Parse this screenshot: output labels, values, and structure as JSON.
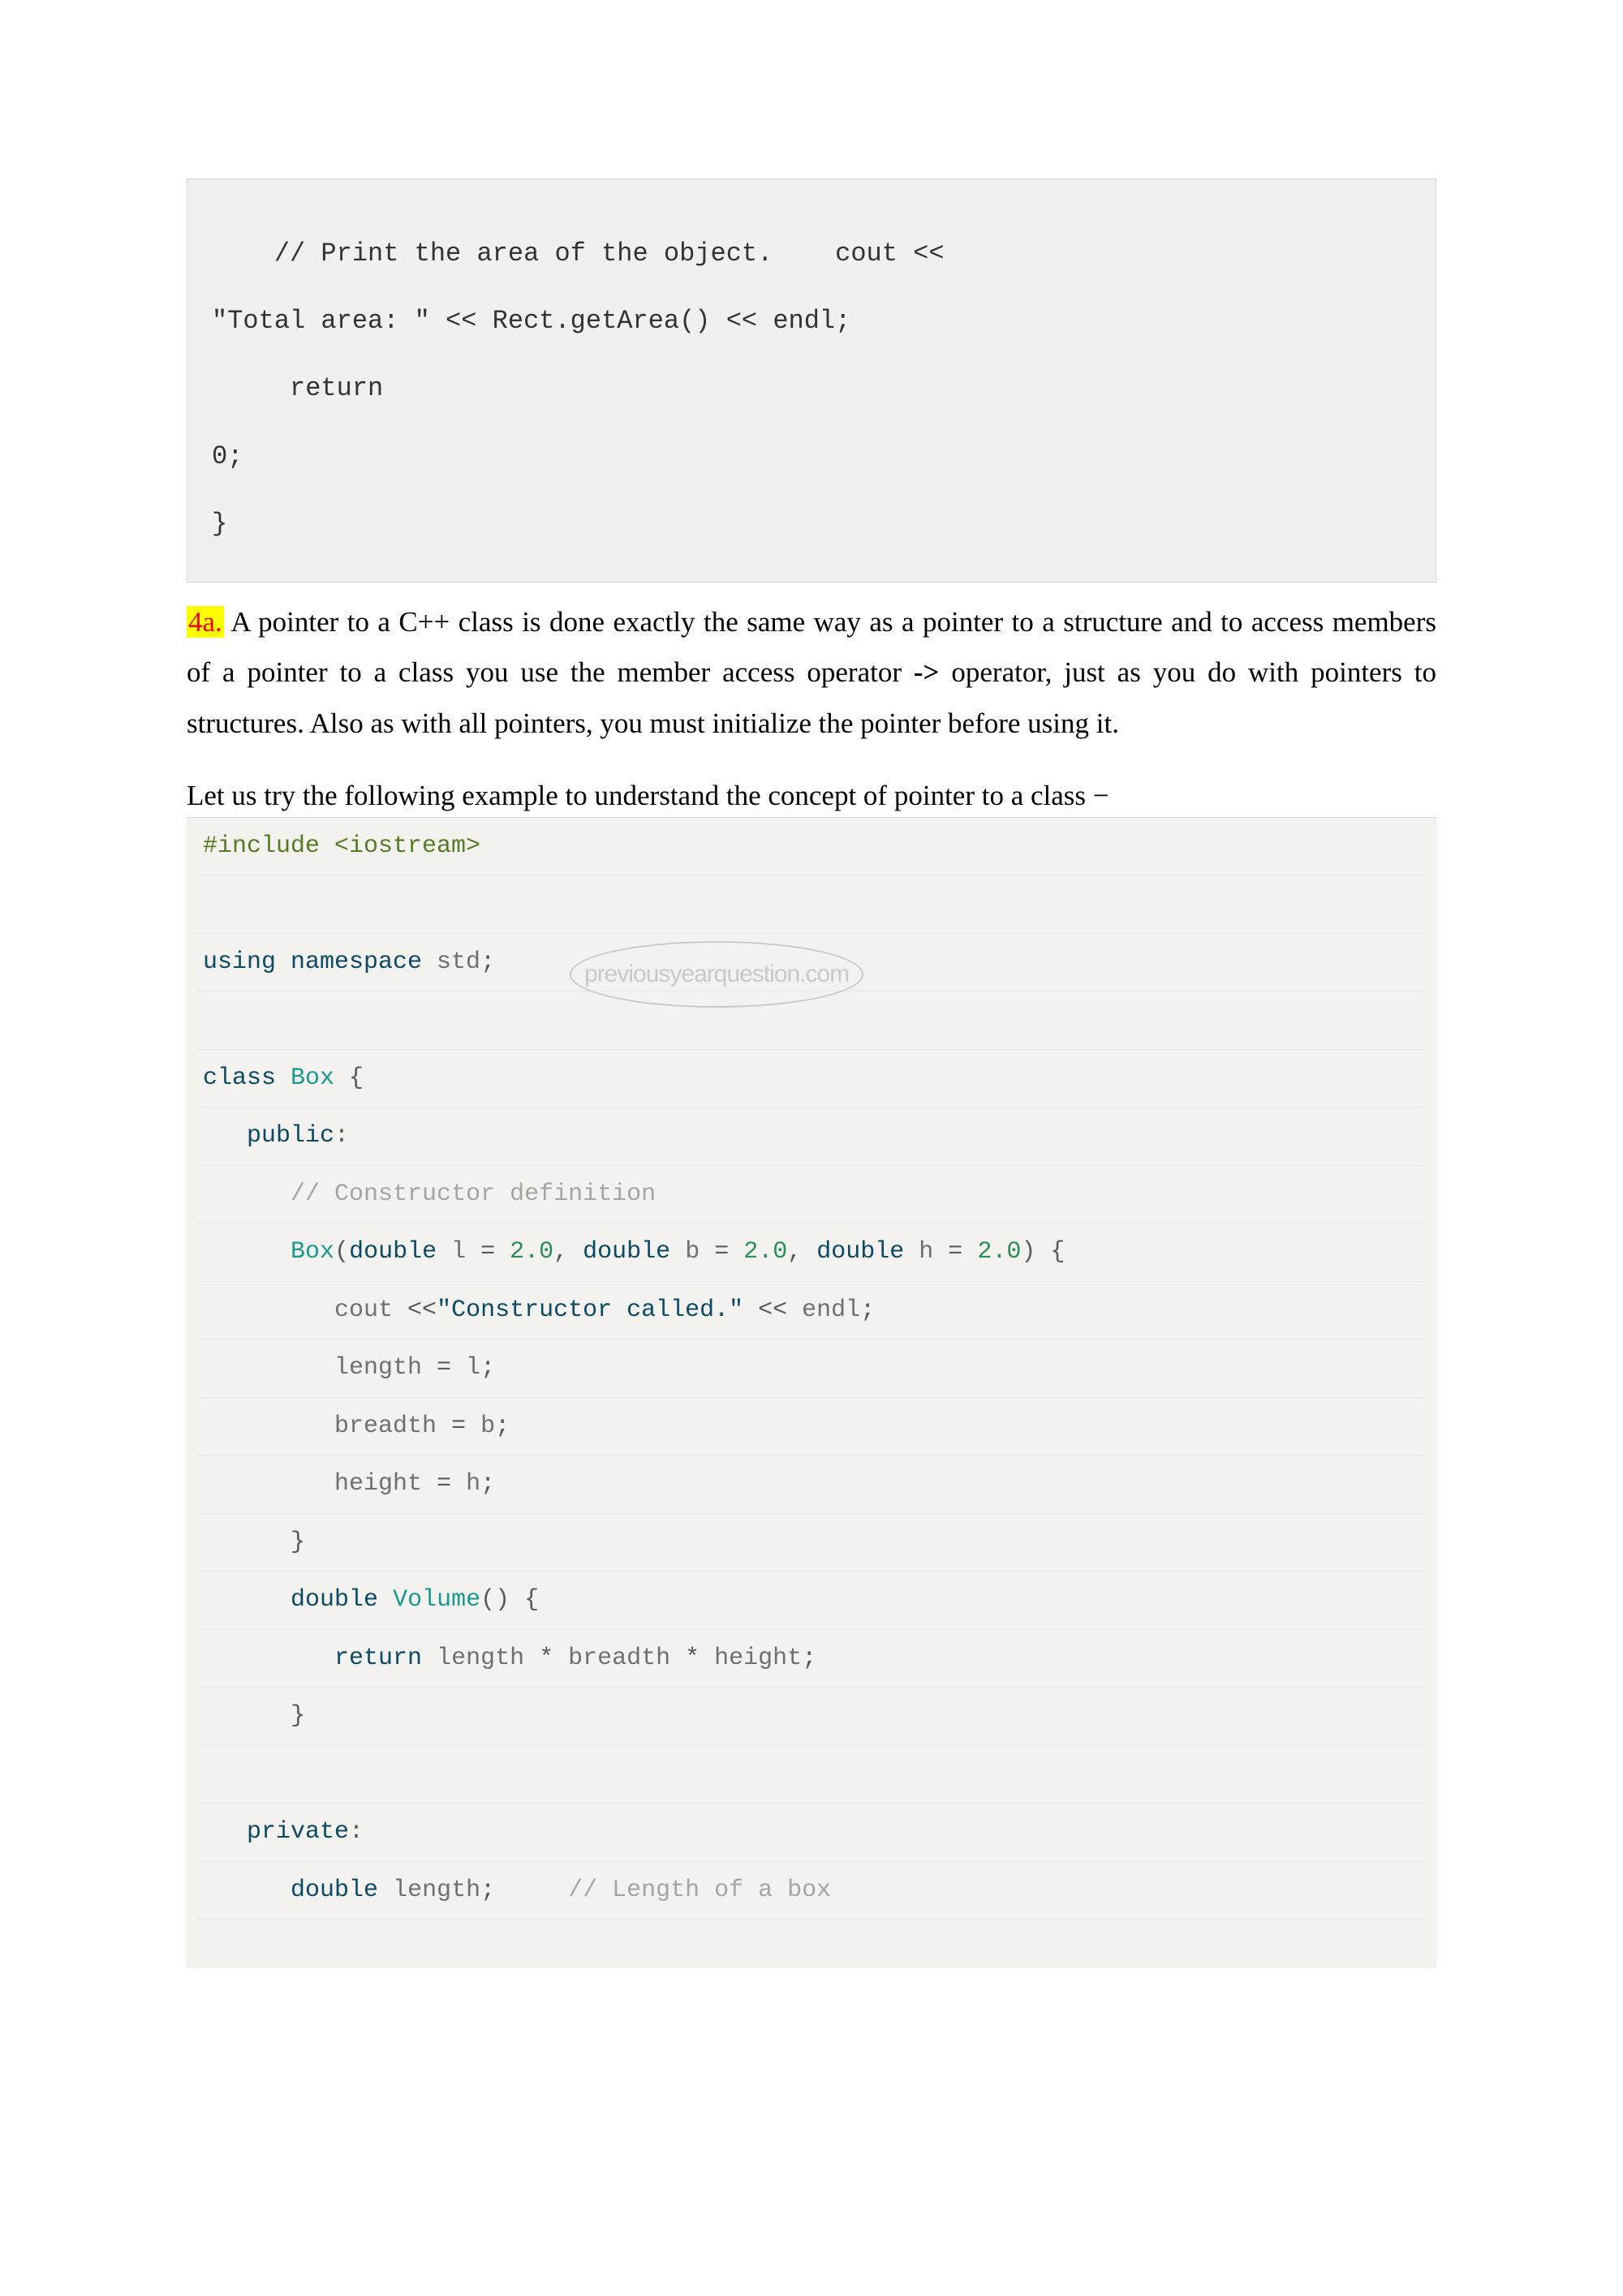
{
  "code1": {
    "l1": "    // Print the area of the object.    cout <<",
    "l2": "\"Total area: \" << Rect.getArea() << endl;",
    "l3": "     return",
    "l4": "0;",
    "l5": "}"
  },
  "para": {
    "tag": "4a.",
    "text1": " A pointer to a C++ class is done exactly the same way as a pointer to a structure and to access members of a pointer to a class you use the member access operator ",
    "op": "->",
    "text2": " operator, just as you do with pointers to structures. Also as with all pointers, you must initialize the pointer before using it."
  },
  "lead": "Let us try the following example to understand the concept of pointer to a class −",
  "watermark": "previousyearquestion.com",
  "code2": {
    "r1_a": "#include ",
    "r1_b": "<iostream>",
    "r2": "",
    "r3_a": "using",
    "r3_b": " namespace",
    "r3_c": " std",
    "r3_d": ";",
    "r4": "",
    "r5_a": "class",
    "r5_b": " Box ",
    "r5_c": "{",
    "r6_a": "   ",
    "r6_b": "public",
    "r6_c": ":",
    "r7_a": "      ",
    "r7_b": "// Constructor definition",
    "r8_a": "      ",
    "r8_b": "Box",
    "r8_c": "(",
    "r8_d": "double",
    "r8_e": " l ",
    "r8_f": "=",
    "r8_g": " 2.0",
    "r8_h": ",",
    "r8_i": " double",
    "r8_j": " b ",
    "r8_k": "=",
    "r8_l": " 2.0",
    "r8_m": ",",
    "r8_n": " double",
    "r8_o": " h ",
    "r8_p": "=",
    "r8_q": " 2.0",
    "r8_r": ")",
    "r8_s": " {",
    "r9_a": "         cout ",
    "r9_b": "<<",
    "r9_c": "\"Constructor called.\"",
    "r9_d": " <<",
    "r9_e": " endl",
    "r9_f": ";",
    "r10_a": "         length ",
    "r10_b": "=",
    "r10_c": " l",
    "r10_d": ";",
    "r11_a": "         breadth ",
    "r11_b": "=",
    "r11_c": " b",
    "r11_d": ";",
    "r12_a": "         height ",
    "r12_b": "=",
    "r12_c": " h",
    "r12_d": ";",
    "r13_a": "      ",
    "r13_b": "}",
    "r14_a": "      ",
    "r14_b": "double",
    "r14_c": " Volume",
    "r14_d": "()",
    "r14_e": " {",
    "r15_a": "         ",
    "r15_b": "return",
    "r15_c": " length ",
    "r15_d": "*",
    "r15_e": " breadth ",
    "r15_f": "*",
    "r15_g": " height",
    "r15_h": ";",
    "r16_a": "      ",
    "r16_b": "}",
    "r17": "",
    "r18_a": "   ",
    "r18_b": "private",
    "r18_c": ":",
    "r19_a": "      ",
    "r19_b": "double",
    "r19_c": " length",
    "r19_d": ";",
    "r19_e": "     // Length of a box"
  }
}
